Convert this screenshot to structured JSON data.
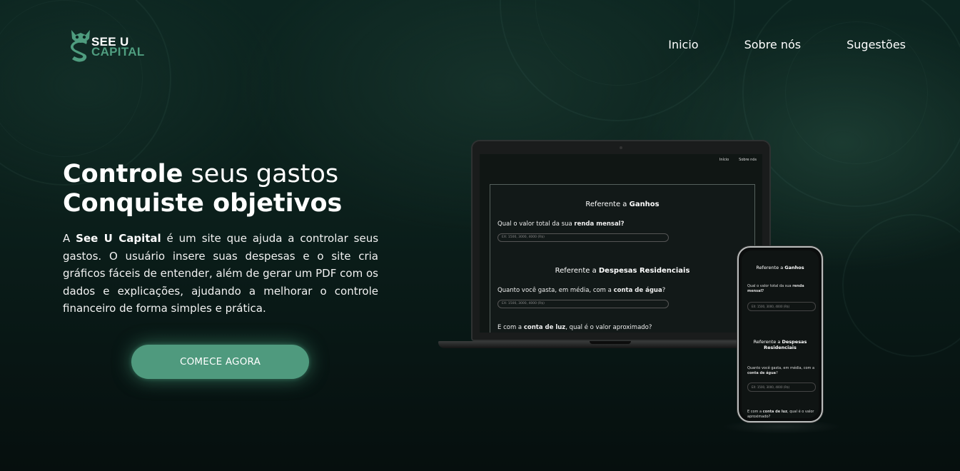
{
  "brand": {
    "name_top": "SEE U",
    "name_bottom": "CAPITAL",
    "accent_color": "#4f9a7e"
  },
  "nav": {
    "items": [
      "Inicio",
      "Sobre nós",
      "Sugestões"
    ]
  },
  "hero": {
    "headline_line1_bold": "Controle",
    "headline_line1_light": " seus gastos",
    "headline_line2": "Conquiste objetivos",
    "desc_prefix": "A ",
    "desc_brand": "See U Capital",
    "desc_rest": " é um site que ajuda a controlar seus gastos. O usuário insere suas despesas e o site cria gráficos fáceis de entender, além de gerar um PDF com os dados e explicações, ajudando a melhorar o controle financeiro de forma simples e prática.",
    "cta_label": "COMECE AGORA"
  },
  "laptop_mock": {
    "nav": [
      "Início",
      "Sobre nós"
    ],
    "section1_prefix": "Referente a ",
    "section1_bold": "Ganhos",
    "q1_prefix": "Qual o valor total da sua ",
    "q1_bold": "renda mensal?",
    "q1_placeholder": "EX: 1500, 3000, 4000 (R$)",
    "section2_prefix": "Referente a ",
    "section2_bold": "Despesas Residenciais",
    "q2_prefix": "Quanto você gasta, em média, com a ",
    "q2_bold": "conta de água",
    "q2_suffix": "?",
    "q2_placeholder": "EX: 1500, 3000, 4000 (R$)",
    "q3_prefix": "E com a ",
    "q3_bold": "conta de luz",
    "q3_suffix": ", qual é o valor aproximado?"
  },
  "phone_mock": {
    "section1_prefix": "Referente a ",
    "section1_bold": "Ganhos",
    "q1_prefix": "Qual o valor total da sua ",
    "q1_bold": "renda mensal?",
    "q1_placeholder": "EX: 1500, 3000, 4000 (R$)",
    "section2_prefix": "Referente a ",
    "section2_bold_line1": "Despesas",
    "section2_bold_line2": "Residenciais",
    "q2_prefix": "Quanto você gasta, em média, com a ",
    "q2_bold": "conta de água",
    "q2_suffix": "?",
    "q2_placeholder": "EX: 1500, 3000, 4000 (R$)",
    "q3_prefix": "E com a ",
    "q3_bold": "conta de luz",
    "q3_suffix": ", qual é o valor aproximado?"
  }
}
